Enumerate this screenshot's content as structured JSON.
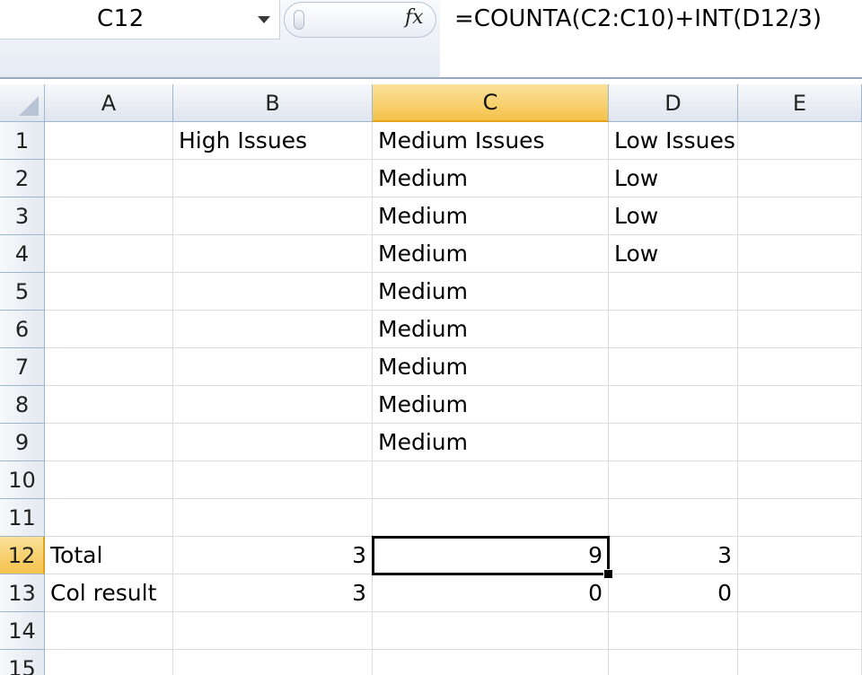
{
  "name_box": {
    "value": "C12"
  },
  "formula_bar": {
    "fx_label": "fx",
    "formula": "=COUNTA(C2:C10)+INT(D12/3)"
  },
  "sheet": {
    "columns": [
      "A",
      "B",
      "C",
      "D",
      "E"
    ],
    "rows": [
      {
        "num": "1",
        "cells": [
          "",
          "High Issues",
          "Medium Issues",
          "Low Issues",
          ""
        ]
      },
      {
        "num": "2",
        "cells": [
          "",
          "",
          "Medium",
          "Low",
          ""
        ]
      },
      {
        "num": "3",
        "cells": [
          "",
          "",
          "Medium",
          "Low",
          ""
        ]
      },
      {
        "num": "4",
        "cells": [
          "",
          "",
          "Medium",
          "Low",
          ""
        ]
      },
      {
        "num": "5",
        "cells": [
          "",
          "",
          "Medium",
          "",
          ""
        ]
      },
      {
        "num": "6",
        "cells": [
          "",
          "",
          "Medium",
          "",
          ""
        ]
      },
      {
        "num": "7",
        "cells": [
          "",
          "",
          "Medium",
          "",
          ""
        ]
      },
      {
        "num": "8",
        "cells": [
          "",
          "",
          "Medium",
          "",
          ""
        ]
      },
      {
        "num": "9",
        "cells": [
          "",
          "",
          "Medium",
          "",
          ""
        ]
      },
      {
        "num": "10",
        "cells": [
          "",
          "",
          "",
          "",
          ""
        ]
      },
      {
        "num": "11",
        "cells": [
          "",
          "",
          "",
          "",
          ""
        ]
      },
      {
        "num": "12",
        "cells": [
          "Total",
          "3",
          "9",
          "3",
          ""
        ]
      },
      {
        "num": "13",
        "cells": [
          "Col result",
          "3",
          "0",
          "0",
          ""
        ]
      },
      {
        "num": "14",
        "cells": [
          "",
          "",
          "",
          "",
          ""
        ]
      },
      {
        "num": "15",
        "cells": [
          "",
          "",
          "",
          "",
          ""
        ]
      }
    ],
    "numeric_cells": [
      "B12",
      "C12",
      "D12",
      "B13",
      "C13",
      "D13"
    ],
    "active_cell": "C12",
    "active_column": "C",
    "active_row": "12"
  },
  "colors": {
    "active_header": "#f4c24c",
    "gridline": "#dadcdd",
    "header_border": "#9eb6ce"
  }
}
